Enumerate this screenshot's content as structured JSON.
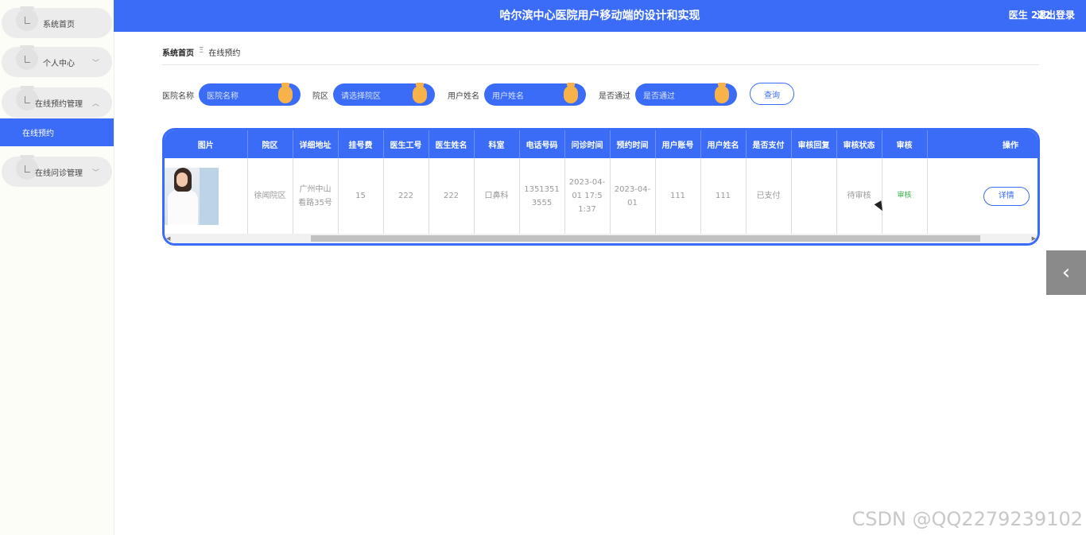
{
  "header": {
    "title": "哈尔滨中心医院用户移动端的设计和实现",
    "user": "医生 222",
    "logout": "退出登录"
  },
  "sidebar": {
    "items": [
      {
        "label": "系统首页"
      },
      {
        "label": "个人中心"
      },
      {
        "label": "在线预约管理"
      },
      {
        "label": "在线问诊管理"
      }
    ],
    "sub_item": "在线预约"
  },
  "breadcrumb": {
    "home": "系统首页",
    "sep": "Ξ",
    "current": "在线预约"
  },
  "search": {
    "hospital_label": "医院名称",
    "hospital_placeholder": "医院名称",
    "district_label": "院区",
    "district_placeholder": "请选择院区",
    "username_label": "用户姓名",
    "username_placeholder": "用户姓名",
    "passed_label": "是否通过",
    "passed_placeholder": "是否通过",
    "query_button": "查询"
  },
  "table": {
    "headers": [
      "图片",
      "院区",
      "详细地址",
      "挂号费",
      "医生工号",
      "医生姓名",
      "科室",
      "电话号码",
      "问诊时间",
      "预约时间",
      "用户账号",
      "用户姓名",
      "是否支付",
      "审核回复",
      "审核状态",
      "审核",
      "操作"
    ],
    "rows": [
      {
        "district": "徐闻院区",
        "address": "广州中山看路35号",
        "fee": "15",
        "doctor_id": "222",
        "doctor_name": "222",
        "department": "口鼻科",
        "phone": "13513513555",
        "consult_time": "2023-04-01 17:51:37",
        "appointment_time": "2023-04-01",
        "user_account": "111",
        "user_name": "111",
        "paid": "已支付",
        "review_reply": "",
        "review_status": "待审核",
        "review_action": "审核",
        "detail_button": "详情"
      }
    ]
  },
  "side_tab": "‹",
  "watermark": "CSDN @QQ2279239102",
  "colors": {
    "primary": "#3b6cf7",
    "knob": "#f7b34a"
  }
}
